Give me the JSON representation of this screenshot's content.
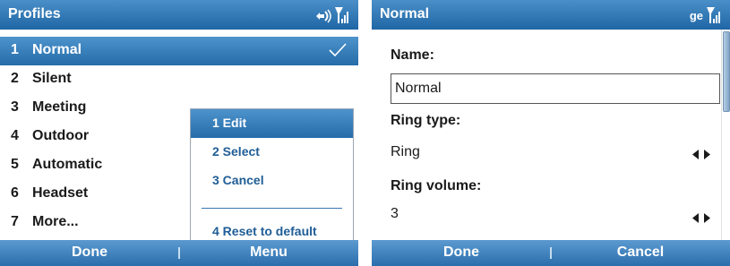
{
  "left_screen": {
    "title": "Profiles",
    "profiles": [
      {
        "num": "1",
        "label": "Normal"
      },
      {
        "num": "2",
        "label": "Silent"
      },
      {
        "num": "3",
        "label": "Meeting"
      },
      {
        "num": "4",
        "label": "Outdoor"
      },
      {
        "num": "5",
        "label": "Automatic"
      },
      {
        "num": "6",
        "label": "Headset"
      },
      {
        "num": "7",
        "label": "More..."
      }
    ],
    "selected_index": 0,
    "context_menu": {
      "items": [
        "1 Edit",
        "2 Select",
        "3 Cancel",
        "4 Reset to default"
      ],
      "active_index": 0
    },
    "softkeys": {
      "left": "Done",
      "right": "Menu"
    }
  },
  "right_screen": {
    "title": "Normal",
    "status_text": "ge",
    "form": {
      "name_label": "Name:",
      "name_value": "Normal",
      "ring_type_label": "Ring type:",
      "ring_type_value": "Ring",
      "ring_volume_label": "Ring volume:",
      "ring_volume_value": "3"
    },
    "softkeys": {
      "left": "Done",
      "right": "Cancel"
    }
  },
  "colors": {
    "accent": "#256ca9",
    "menu_text": "#1f5d96"
  },
  "icons": [
    "connectivity-icon",
    "signal-strength-icon",
    "checkmark-icon",
    "left-arrow-icon",
    "right-arrow-icon"
  ]
}
